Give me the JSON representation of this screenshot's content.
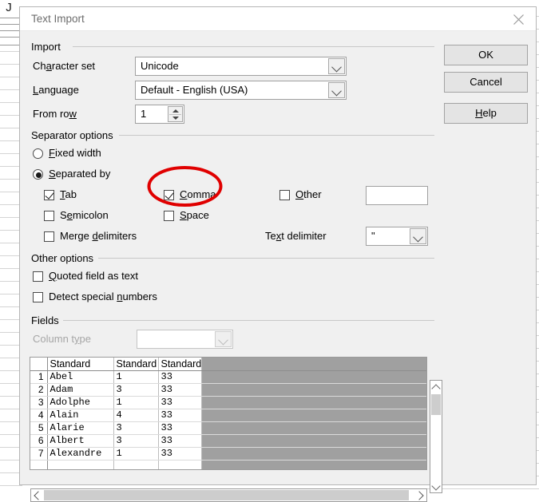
{
  "window": {
    "title": "Text Import",
    "close_icon": "close-x-icon"
  },
  "groups": {
    "import": "Import",
    "separator_options": "Separator options",
    "other_options": "Other options",
    "fields": "Fields"
  },
  "import": {
    "character_set": {
      "label_pre": "Ch",
      "label_accel": "a",
      "label_post": "racter set",
      "value": "Unicode"
    },
    "language": {
      "label_pre": "",
      "label_accel": "L",
      "label_post": "anguage",
      "value": "Default - English (USA)"
    },
    "from_row": {
      "label_pre": "From ro",
      "label_accel": "w",
      "label_post": "",
      "value": "1"
    }
  },
  "separator": {
    "fixed_width": {
      "label_pre": "",
      "label_accel": "F",
      "label_post": "ixed width",
      "checked": false
    },
    "separated_by": {
      "label_pre": "",
      "label_accel": "S",
      "label_post": "eparated by",
      "checked": true
    },
    "tab": {
      "label_pre": "",
      "label_accel": "T",
      "label_post": "ab",
      "checked": true
    },
    "semicolon": {
      "label_pre": "S",
      "label_accel": "e",
      "label_post": "micolon",
      "checked": false
    },
    "merge_delimiters": {
      "label_pre": "Merge ",
      "label_accel": "d",
      "label_post": "elimiters",
      "checked": false
    },
    "comma": {
      "label_pre": "",
      "label_accel": "C",
      "label_post": "omma",
      "checked": true
    },
    "space": {
      "label_pre": "",
      "label_accel": "S",
      "label_post": "pace",
      "checked": false
    },
    "other": {
      "label_pre": "",
      "label_accel": "O",
      "label_post": "ther",
      "checked": false
    },
    "other_value": "",
    "text_delimiter": {
      "label_pre": "Te",
      "label_accel": "x",
      "label_post": "t delimiter",
      "value": "\""
    }
  },
  "other_options": {
    "quoted_field_as_text": {
      "label_pre": "",
      "label_accel": "Q",
      "label_post": "uoted field as text",
      "checked": false
    },
    "detect_special_numbers": {
      "label_pre": "Detect special ",
      "label_accel": "n",
      "label_post": "umbers",
      "checked": false
    }
  },
  "fields": {
    "column_type": {
      "label_pre": "Column t",
      "label_accel": "y",
      "label_post": "pe",
      "value": "",
      "disabled": true
    }
  },
  "preview": {
    "headers": [
      "",
      "Standard",
      "Standard",
      "Standard"
    ],
    "rows": [
      [
        "1",
        "Abel",
        "1",
        "33"
      ],
      [
        "2",
        "Adam",
        "3",
        "33"
      ],
      [
        "3",
        "Adolphe",
        "1",
        "33"
      ],
      [
        "4",
        "Alain",
        "4",
        "33"
      ],
      [
        "5",
        "Alarie",
        "3",
        "33"
      ],
      [
        "6",
        "Albert",
        "3",
        "33"
      ],
      [
        "7",
        "Alexandre",
        "1",
        "33"
      ]
    ]
  },
  "buttons": {
    "ok": {
      "label": "OK",
      "accel": ""
    },
    "cancel": {
      "label": "Cancel",
      "accel": ""
    },
    "help": {
      "label_pre": "",
      "label_accel": "H",
      "label_post": "elp"
    }
  },
  "annotation": {
    "shape": "red-ellipse-highlight",
    "color": "#e00000",
    "target": "comma-checkbox"
  },
  "backdrop": {
    "column_header": "J"
  }
}
